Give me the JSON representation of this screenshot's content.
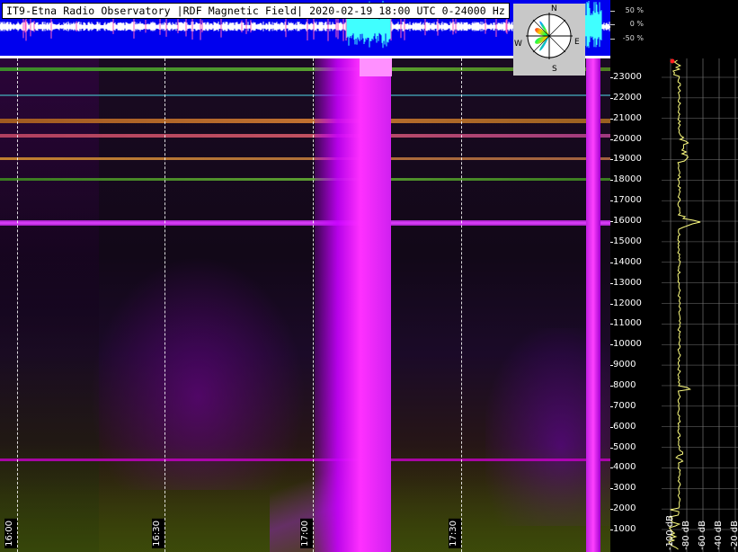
{
  "title": "IT9-Etna Radio Observatory |RDF Magnetic Field| 2020-02-19 18:00 UTC 0-24000 Hz",
  "waveform_scale": [
    "50 %",
    "0 %",
    "-50 %"
  ],
  "compass": {
    "n": "N",
    "s": "S",
    "w": "W",
    "e": "E"
  },
  "time_labels": [
    "16:00",
    "16:30",
    "17:00",
    "17:30"
  ],
  "frequency_labels": [
    "23000",
    "22000",
    "21000",
    "20000",
    "19000",
    "18000",
    "17000",
    "16000",
    "15000",
    "14000",
    "13000",
    "12000",
    "11000",
    "10000",
    "9000",
    "8000",
    "7000",
    "6000",
    "5000",
    "4000",
    "3000",
    "2000",
    "1000"
  ],
  "db_labels": [
    "-100 dB",
    "-80 dB",
    "-60 dB",
    "-40 dB",
    "-20 dB"
  ],
  "colors": {
    "waveform_bg": "#0000ee",
    "trace": "#ffff80",
    "magenta": "#ff00ff"
  }
}
